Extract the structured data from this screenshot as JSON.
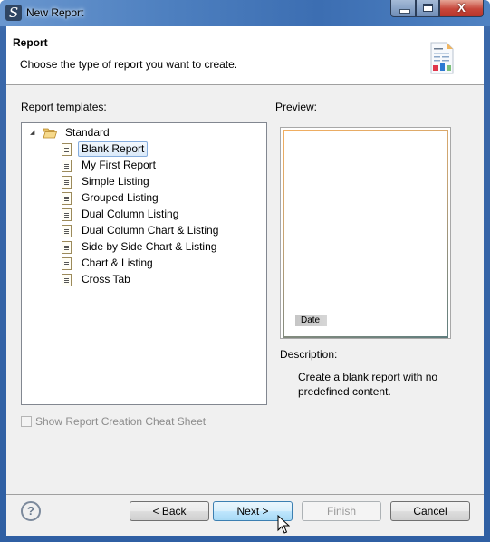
{
  "window": {
    "title": "New Report",
    "controls": {
      "minimize": "—",
      "maximize": "□",
      "close": "X"
    }
  },
  "header": {
    "title": "Report",
    "description": "Choose the type of report you want to create."
  },
  "templates": {
    "label": "Report templates:",
    "root": {
      "label": "Standard",
      "expanded": true
    },
    "items": [
      {
        "label": "Blank Report",
        "selected": true
      },
      {
        "label": "My First Report",
        "selected": false
      },
      {
        "label": "Simple Listing",
        "selected": false
      },
      {
        "label": "Grouped Listing",
        "selected": false
      },
      {
        "label": "Dual Column Listing",
        "selected": false
      },
      {
        "label": "Dual Column Chart & Listing",
        "selected": false
      },
      {
        "label": "Side by Side Chart & Listing",
        "selected": false
      },
      {
        "label": "Chart & Listing",
        "selected": false
      },
      {
        "label": "Cross Tab",
        "selected": false
      }
    ]
  },
  "preview": {
    "label": "Preview:",
    "date_chip": "Date"
  },
  "description": {
    "label": "Description:",
    "text": "Create a blank report with no predefined content."
  },
  "cheat_sheet": {
    "label": "Show Report Creation Cheat Sheet",
    "checked": false,
    "enabled": false
  },
  "buttons": {
    "help": "?",
    "back": "< Back",
    "next": "Next >",
    "finish": "Finish",
    "cancel": "Cancel"
  }
}
